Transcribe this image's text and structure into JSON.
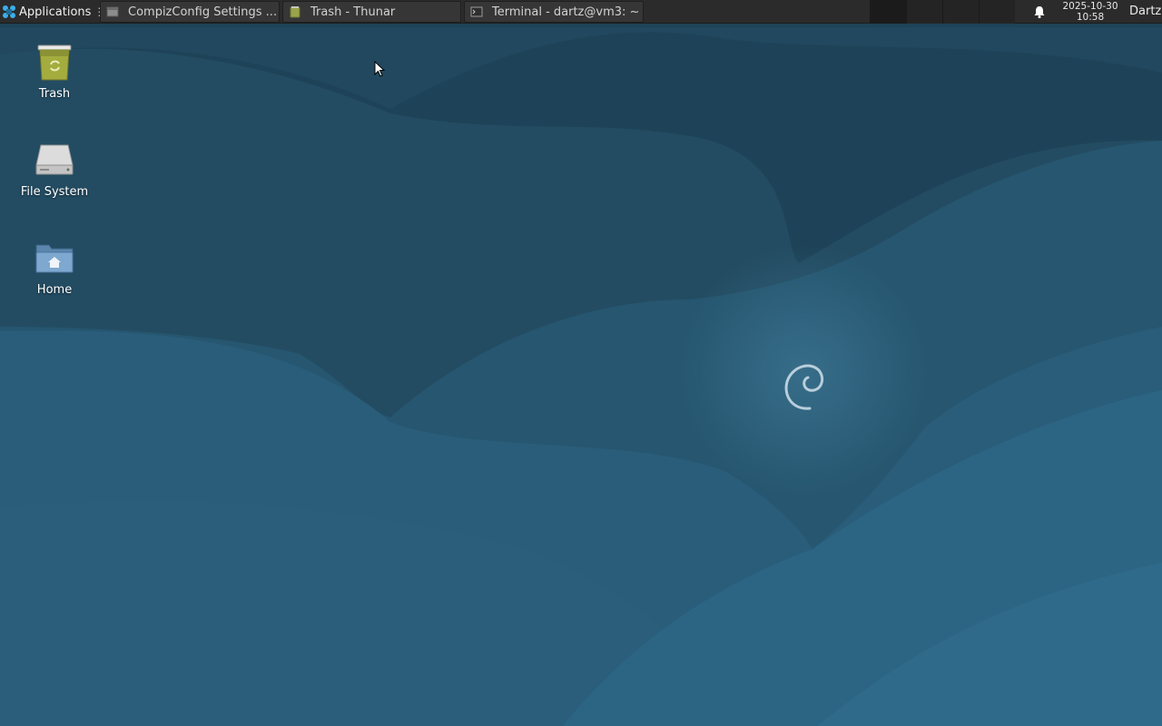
{
  "panel": {
    "applications_label": "Applications",
    "applications_sep": "⋮",
    "tasks": [
      {
        "title": "CompizConfig Settings ...",
        "icon": "settings-window-icon"
      },
      {
        "title": "Trash - Thunar",
        "icon": "trash-folder-icon"
      },
      {
        "title": "Terminal - dartz@vm3: ~",
        "icon": "terminal-icon"
      }
    ],
    "workspace_count": 4,
    "clock": {
      "date": "2025-10-30",
      "time": "10:58"
    },
    "user": "Dartz"
  },
  "desktop": {
    "icons": [
      {
        "label": "Trash",
        "icon": "trash-icon"
      },
      {
        "label": "File System",
        "icon": "drive-icon"
      },
      {
        "label": "Home",
        "icon": "home-folder-icon"
      }
    ],
    "wallpaper": "debian-swirl-wallpaper"
  },
  "colors": {
    "panel_bg": "#2b2b2b",
    "wallpaper_dark": "#1e4358",
    "wallpaper_light": "#2e6a8b",
    "accent": "#3daee9"
  }
}
